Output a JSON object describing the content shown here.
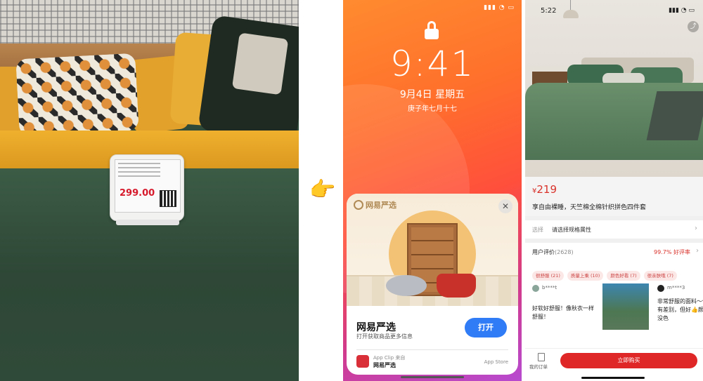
{
  "photo": {
    "price_tag": "299.00"
  },
  "pointer": {
    "icon": "pointing-hand-icon",
    "glyph": "👉"
  },
  "lock_screen": {
    "time": "9:41",
    "date": "9月4日 星期五",
    "lunar_date": "庚子年七月十七",
    "clip": {
      "brand_logo": "网易严选",
      "app_name": "网易严选",
      "description": "打开获取商品更多信息",
      "open_label": "打开",
      "from_label": "App Clip 来自",
      "from_name": "网易严选",
      "store_label": "App Store",
      "close_glyph": "✕"
    }
  },
  "product": {
    "status_time": "5:22",
    "currency": "¥",
    "price": "219",
    "title": "享自由裸睡，天竺棉全棉针织拼色四件套",
    "spec_label": "选择",
    "spec_value": "请选择规格属性",
    "reviews_title": "用户评价",
    "reviews_count": "(2628)",
    "positive_rate": "99.7% 好评率",
    "tags": [
      "很舒服 (21)",
      "质量上乘 (10)",
      "颜色好看 (7)",
      "很亲肤哦 (7)"
    ],
    "review1_user": "b****t",
    "review1_text": "好软好舒服！像秋衣一样舒服！",
    "review2_user": "m****3",
    "review2_text": "非常舒服的面料～像的有差别，但好👍颜色没色",
    "orders_label": "我的订单",
    "buy_label": "立即购买",
    "chevron": "›"
  }
}
